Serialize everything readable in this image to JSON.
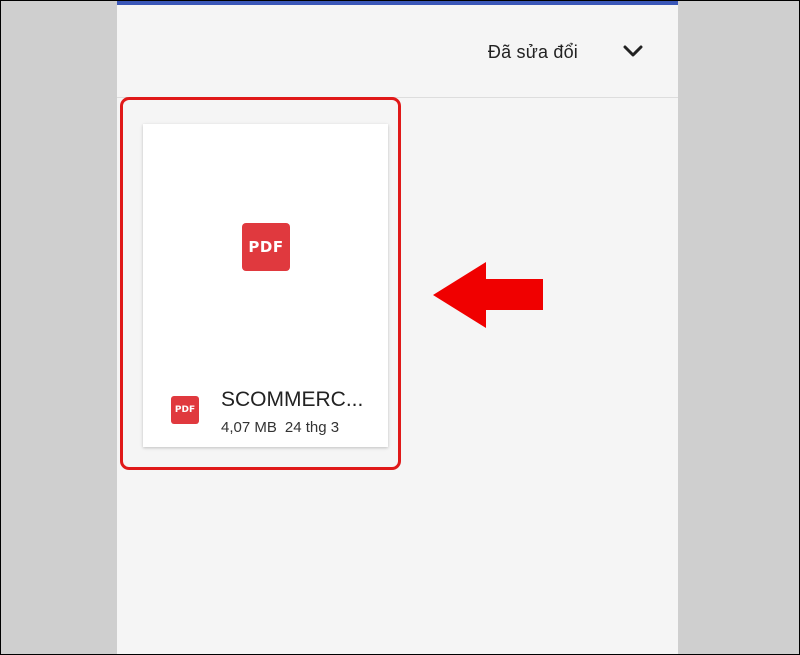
{
  "sort": {
    "label": "Đã sửa đổi",
    "chevron_icon": "chevron-down-icon"
  },
  "file": {
    "thumbnail_label": "PDF",
    "type_label": "PDF",
    "name": "SCOMMERC...",
    "size": "4,07 MB",
    "modified": "24 thg 3"
  },
  "annotations": {
    "highlight_color": "#e01919",
    "arrow_icon": "arrow-left-icon",
    "arrow_color": "#f00000"
  },
  "colors": {
    "pdf_red": "#e0393e",
    "accent_blue": "#3a57b8"
  }
}
